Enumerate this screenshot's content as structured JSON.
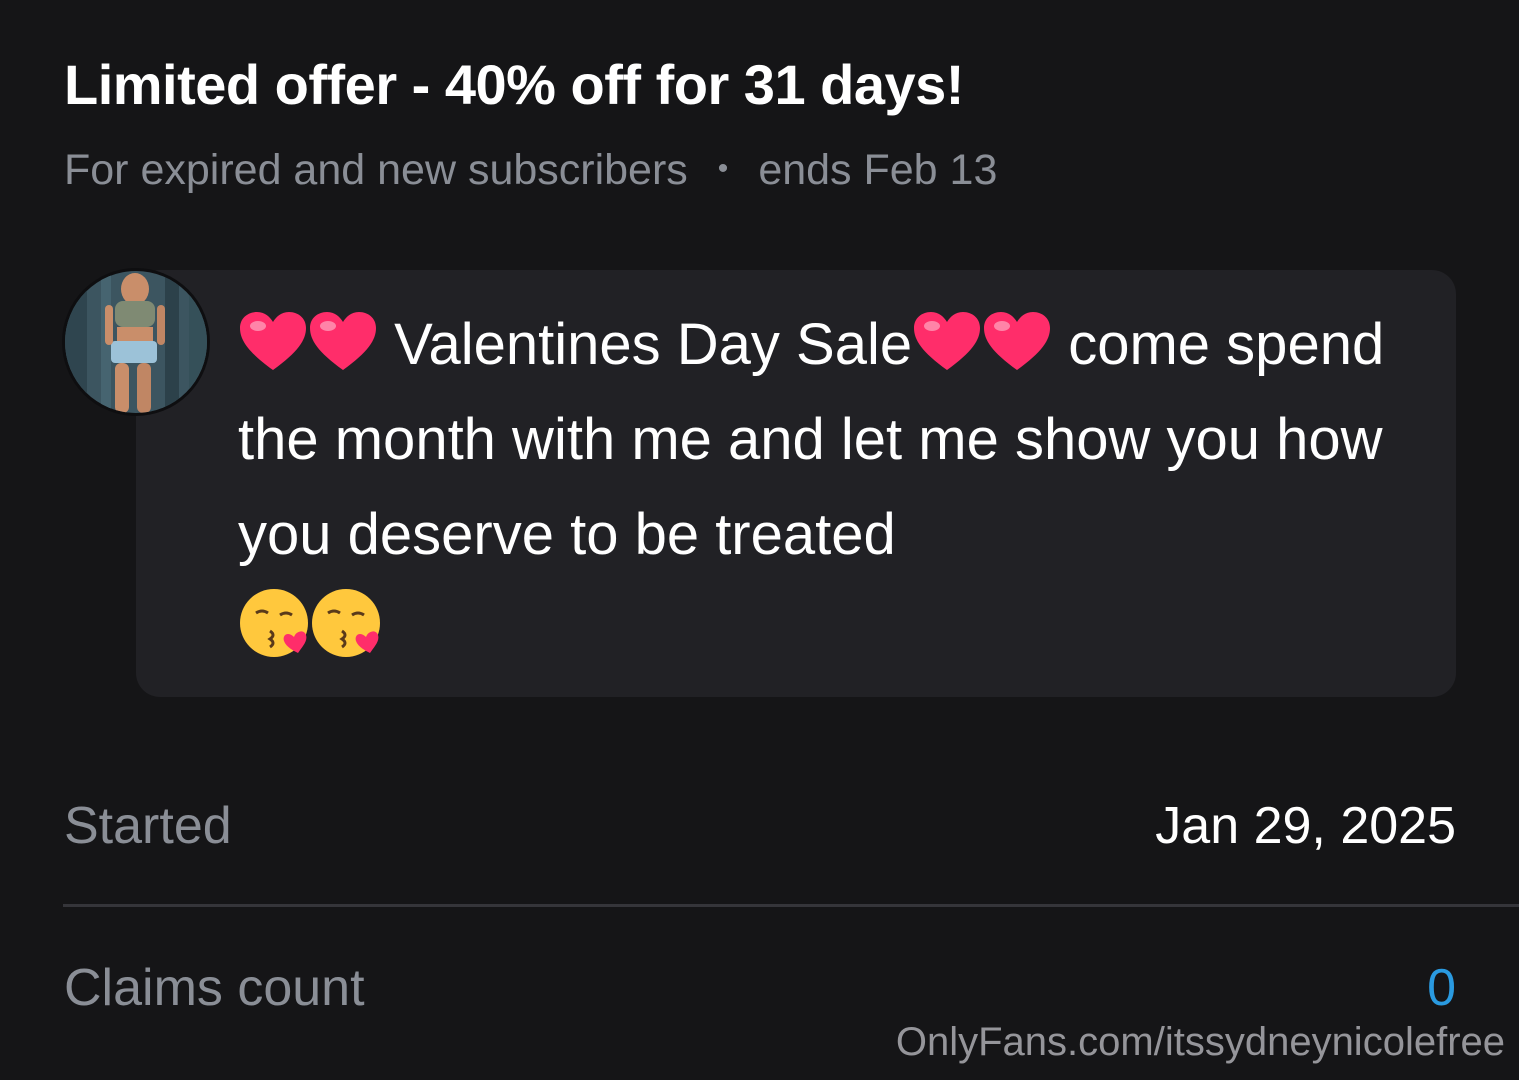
{
  "offer": {
    "title": "Limited offer - 40% off for 31 days!",
    "audience": "For expired and new subscribers",
    "separator": "•",
    "ends": "ends Feb 13"
  },
  "message": {
    "text_part1": " Valentines Day Sale",
    "text_part2": " come spend the month with me and let me show you how you deserve to be treated",
    "icons": [
      "red-heart-icon",
      "kissing-face-icon"
    ]
  },
  "details": {
    "started_label": "Started",
    "started_value": "Jan 29, 2025",
    "claims_label": "Claims count",
    "claims_value": "0"
  },
  "watermark": "OnlyFans.com/itssydneynicolefree",
  "colors": {
    "background": "#151517",
    "card": "#212125",
    "muted_text": "#8a8e96",
    "accent_count": "#2a9ae0"
  }
}
